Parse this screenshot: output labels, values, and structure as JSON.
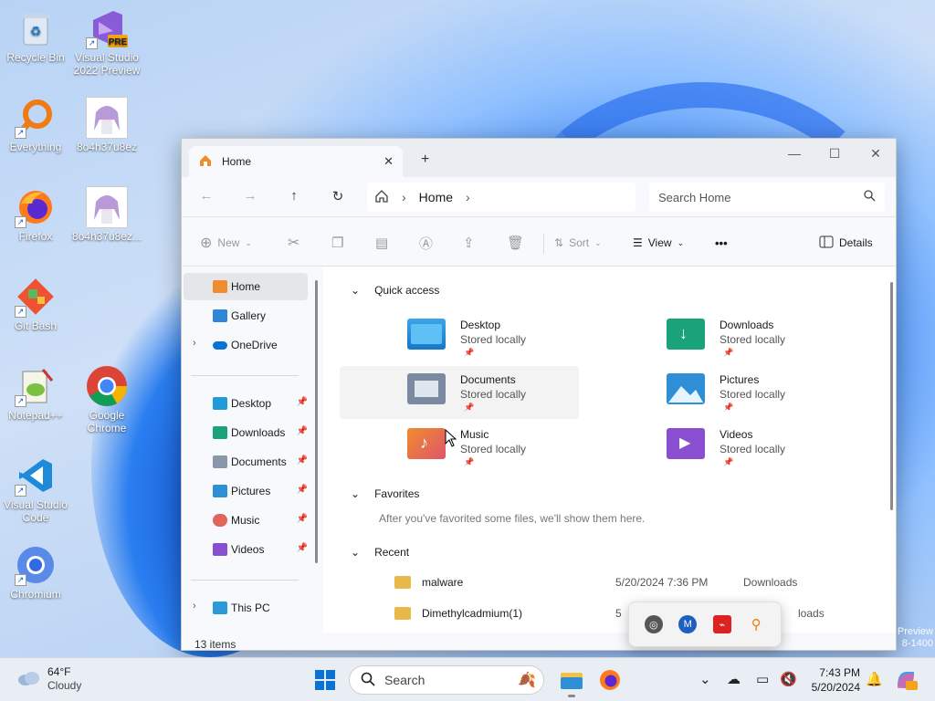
{
  "desktop": {
    "icons": [
      {
        "label": "Recycle Bin",
        "icon": "recycle-bin-icon"
      },
      {
        "label": "Visual Studio 2022 Preview",
        "icon": "visual-studio-preview-icon",
        "badge": "PRE"
      },
      {
        "label": "Everything",
        "icon": "everything-search-icon"
      },
      {
        "label": "8o4h37u8ez",
        "icon": "anime-image-icon"
      },
      {
        "label": "Firefox",
        "icon": "firefox-icon"
      },
      {
        "label": "8o4h37u8ez...",
        "icon": "anime-image-icon"
      },
      {
        "label": "Git Bash",
        "icon": "git-bash-icon"
      },
      {
        "label": "Notepad++",
        "icon": "notepadpp-icon"
      },
      {
        "label": "Google Chrome",
        "icon": "chrome-icon"
      },
      {
        "label": "Visual Studio Code",
        "icon": "vscode-icon"
      },
      {
        "label": "Chromium",
        "icon": "chromium-icon"
      }
    ],
    "watermark": "Preview\n8-1400"
  },
  "explorer": {
    "tab_title": "Home",
    "tab_close": "✕",
    "new_tab": "+",
    "window_controls": {
      "minimize": "—",
      "maximize": "☐",
      "close": "✕"
    },
    "breadcrumb": {
      "home_icon": "home-icon",
      "location": "Home"
    },
    "search_placeholder": "Search Home",
    "toolbar": {
      "new": "New",
      "sort": "Sort",
      "view": "View",
      "more": "•••",
      "details": "Details"
    },
    "nav": {
      "items": [
        {
          "label": "Home",
          "icon": "home-icon"
        },
        {
          "label": "Gallery",
          "icon": "gallery-icon"
        },
        {
          "label": "OneDrive",
          "icon": "onedrive-icon"
        },
        {
          "label": "Desktop",
          "icon": "desktop-folder-icon"
        },
        {
          "label": "Downloads",
          "icon": "downloads-folder-icon"
        },
        {
          "label": "Documents",
          "icon": "documents-folder-icon"
        },
        {
          "label": "Pictures",
          "icon": "pictures-folder-icon"
        },
        {
          "label": "Music",
          "icon": "music-folder-icon"
        },
        {
          "label": "Videos",
          "icon": "videos-folder-icon"
        },
        {
          "label": "This PC",
          "icon": "this-pc-icon"
        }
      ]
    },
    "sections": {
      "quick_access": "Quick access",
      "favorites": "Favorites",
      "recent": "Recent"
    },
    "favorites_empty": "After you've favorited some files, we'll show them here.",
    "quick_access": [
      {
        "name": "Desktop",
        "sub": "Stored locally",
        "color": "#1f8fd9"
      },
      {
        "name": "Downloads",
        "sub": "Stored locally",
        "color": "#1aa37a"
      },
      {
        "name": "Documents",
        "sub": "Stored locally",
        "color": "#7a8aa0"
      },
      {
        "name": "Pictures",
        "sub": "Stored locally",
        "color": "#2e8fd6"
      },
      {
        "name": "Music",
        "sub": "Stored locally",
        "color": "#e0655a"
      },
      {
        "name": "Videos",
        "sub": "Stored locally",
        "color": "#8a4fd0"
      }
    ],
    "recent": [
      {
        "name": "malware",
        "date": "5/20/2024 7:36 PM",
        "location": "Downloads"
      },
      {
        "name": "Dimethylcadmium(1)",
        "date": "5",
        "location": "loads"
      }
    ],
    "status": "13 items"
  },
  "taskbar": {
    "weather": {
      "temp": "64°F",
      "condition": "Cloudy"
    },
    "search_placeholder": "Search",
    "clock": {
      "time": "7:43 PM",
      "date": "5/20/2024"
    }
  }
}
